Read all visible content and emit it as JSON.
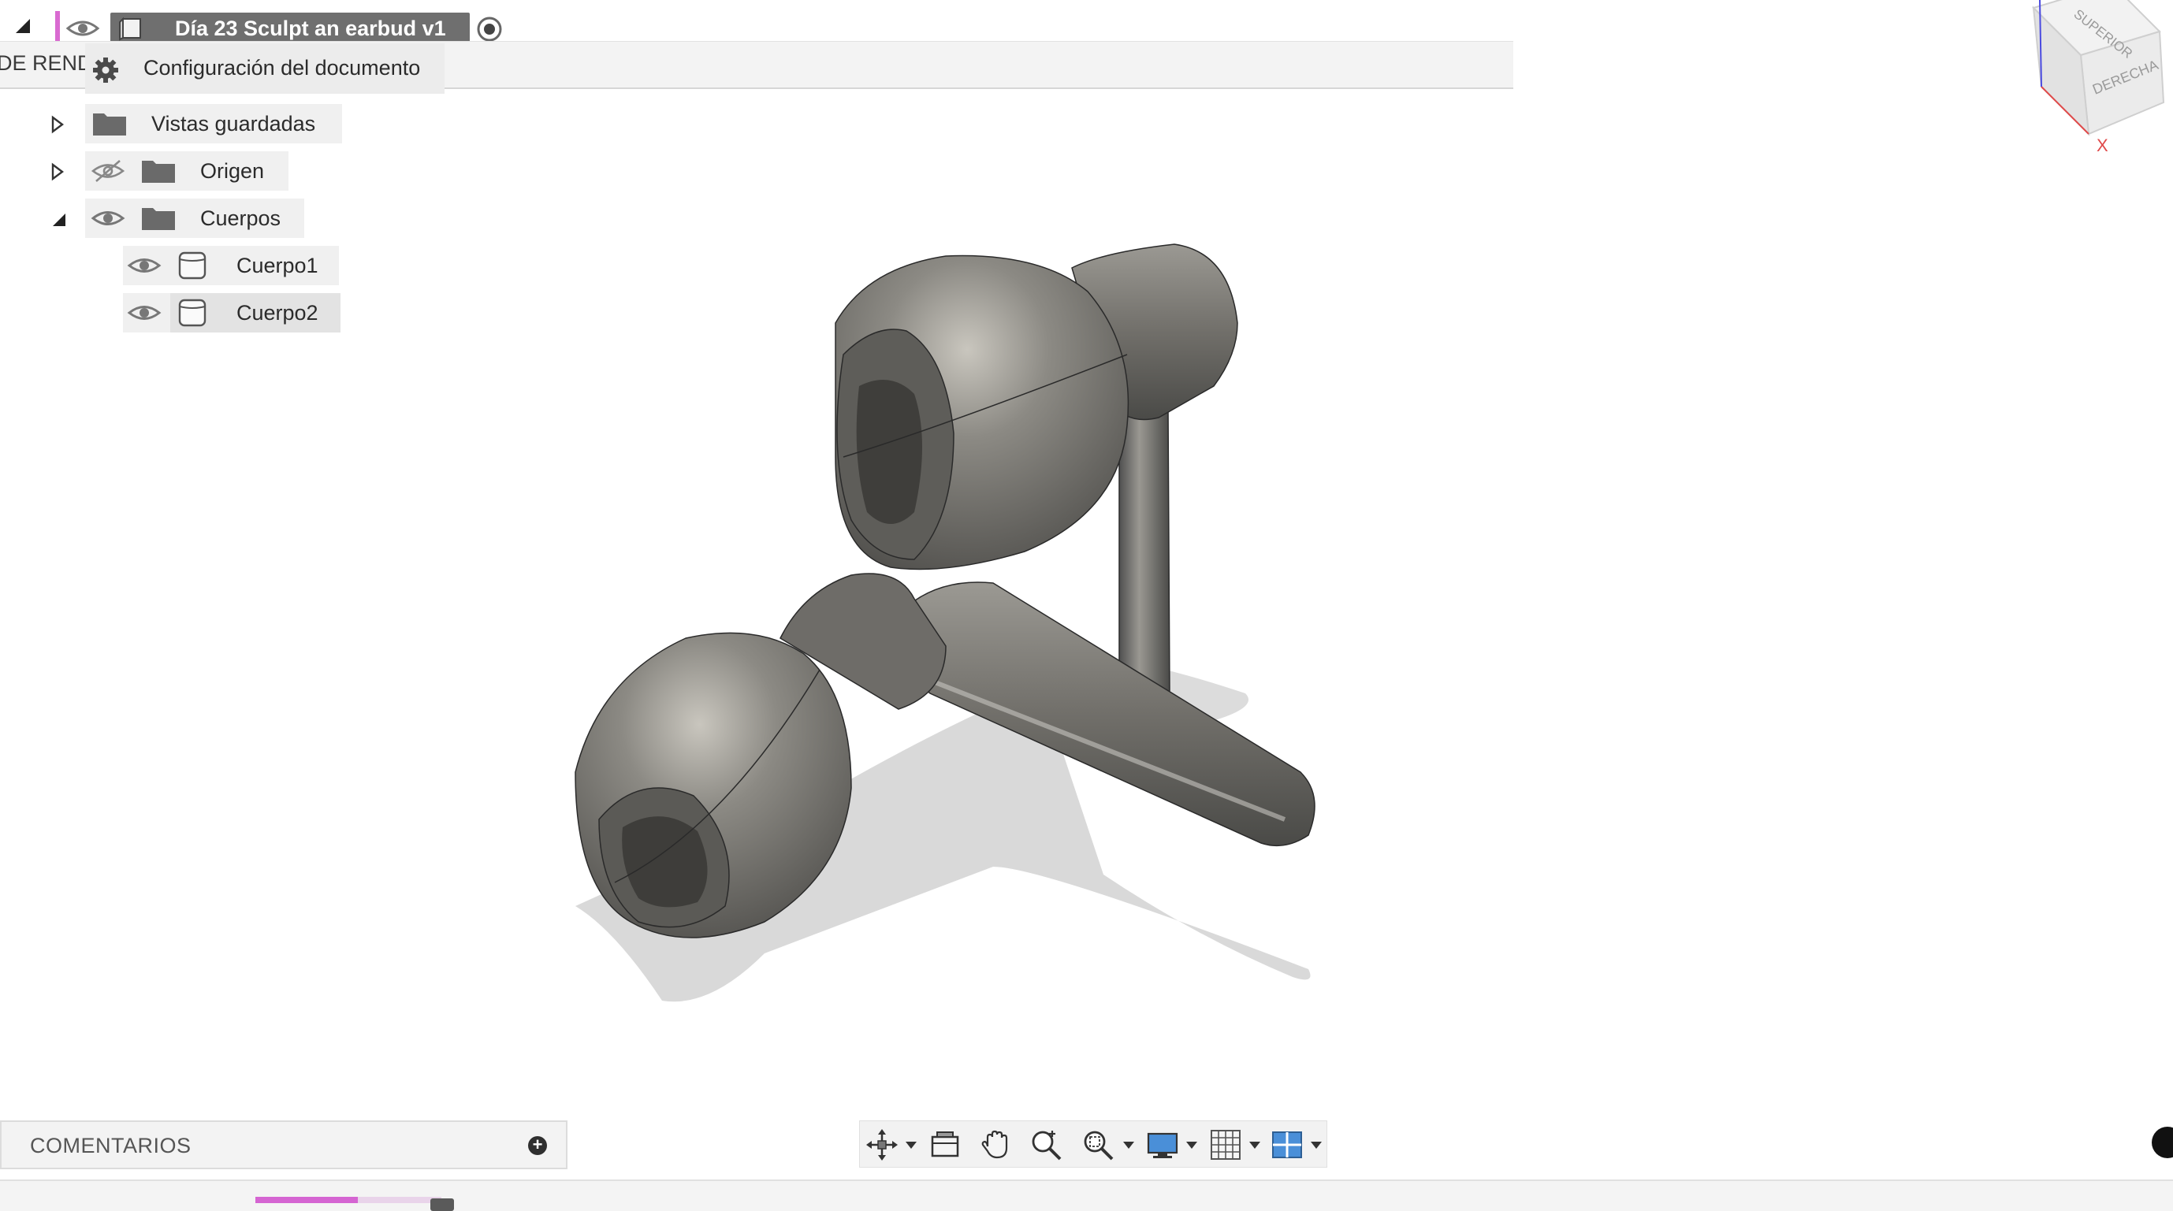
{
  "browser": {
    "document_title": "Día 23 Sculpt an earbud v1",
    "render_label_partial": "DE RENDE",
    "settings_label": "Configuración del documento",
    "items": [
      {
        "label": "Vistas guardadas"
      },
      {
        "label": "Origen"
      },
      {
        "label": "Cuerpos"
      },
      {
        "label": "Cuerpo1"
      },
      {
        "label": "Cuerpo2"
      }
    ]
  },
  "comments": {
    "label": "COMENTARIOS"
  },
  "toolbar": {
    "icons": [
      "orbit-icon",
      "look-at-icon",
      "pan-icon",
      "zoom-icon",
      "fit-icon",
      "display-settings-icon",
      "grid-icon",
      "viewports-icon"
    ]
  },
  "viewcube": {
    "top_label": "SUPERIOR",
    "right_label": "DERECHA",
    "axis_label": "X"
  },
  "timeline": {
    "progress_percent": 55
  },
  "colors": {
    "accent": "#d565d2",
    "selected_row": "#e3e3e3",
    "model": "#6b6a66"
  }
}
